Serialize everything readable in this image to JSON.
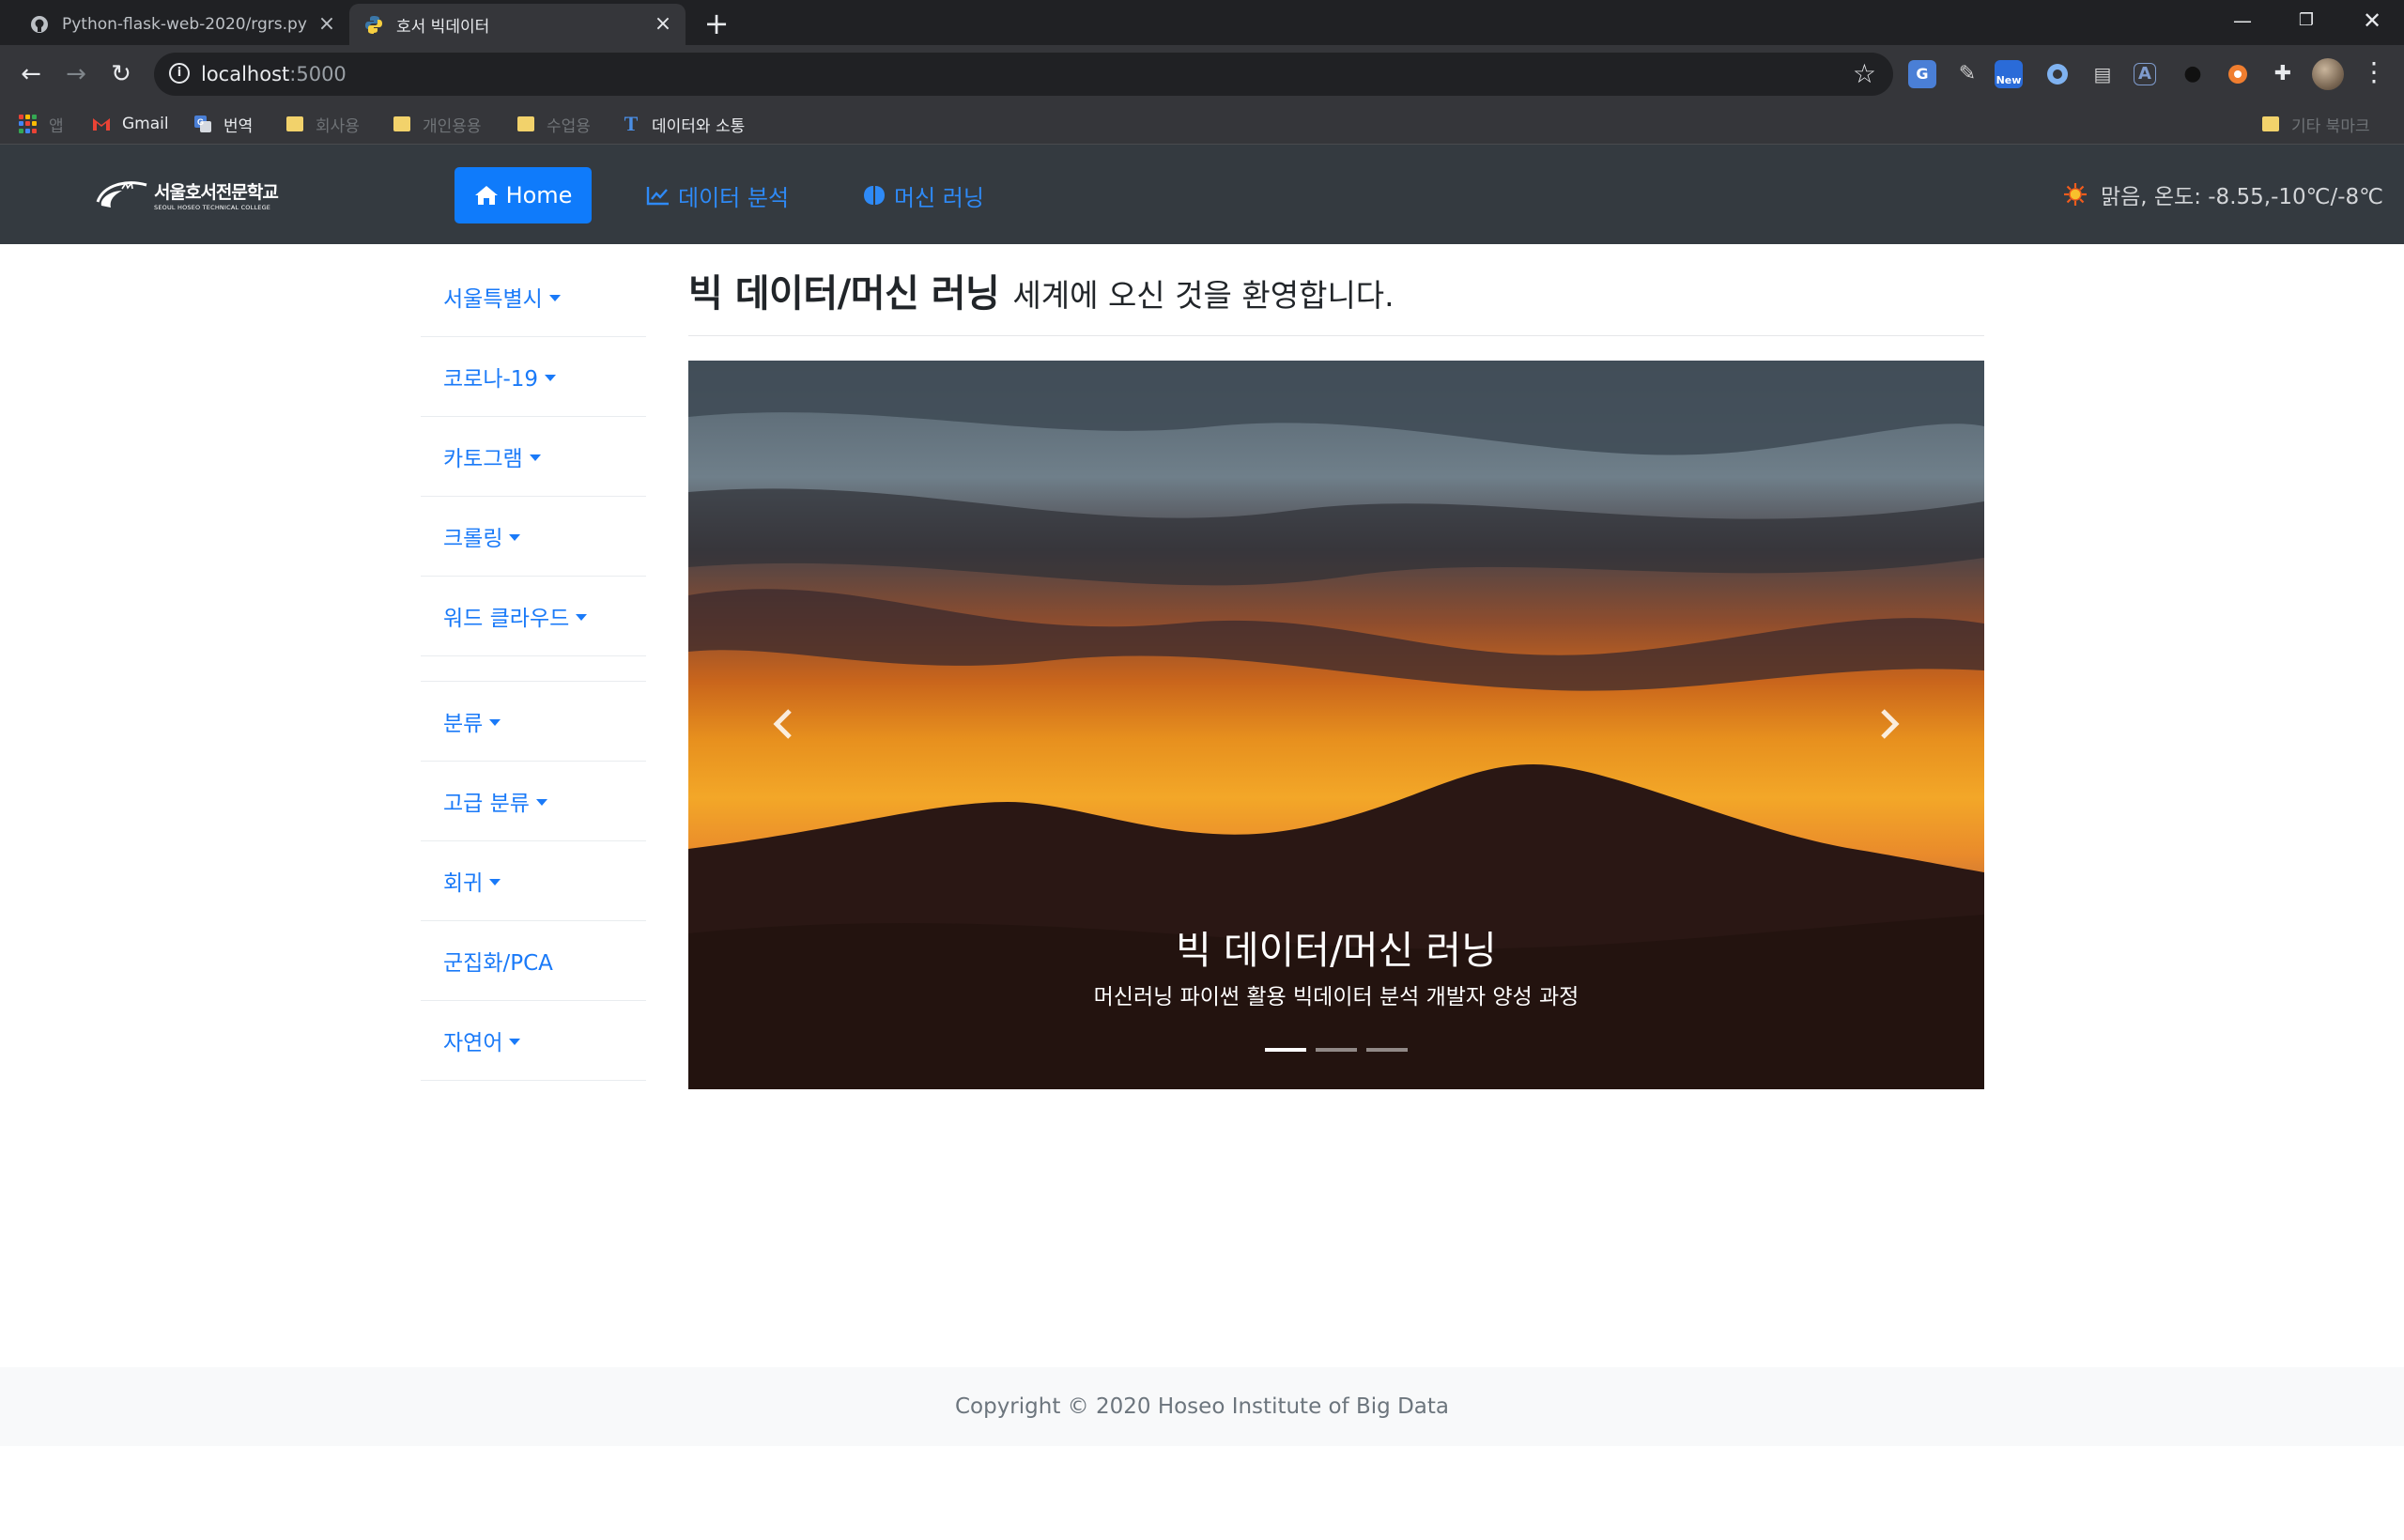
{
  "browser": {
    "tabs": [
      {
        "title": "Python-flask-web-2020/rgrs.py",
        "icon": "github-icon",
        "active": false
      },
      {
        "title": "호서 빅데이터",
        "icon": "python-icon",
        "active": true
      }
    ],
    "url_host": "localhost",
    "url_port": ":5000",
    "bookmarks": [
      {
        "label": "앱",
        "icon": "apps-grid-icon",
        "dim": true
      },
      {
        "label": "Gmail",
        "icon": "gmail-icon",
        "dim": false
      },
      {
        "label": "번역",
        "icon": "translate-icon",
        "dim": false
      },
      {
        "label": "회사용",
        "icon": "folder-icon",
        "dim": true
      },
      {
        "label": "개인용용",
        "icon": "folder-icon",
        "dim": true
      },
      {
        "label": "수업용",
        "icon": "folder-icon",
        "dim": true
      },
      {
        "label": "데이터와 소통",
        "icon": "t-logo-icon",
        "dim": false
      }
    ],
    "other_bookmarks": "기타 북마크",
    "new_badge": "New"
  },
  "site": {
    "logo_text": "서울호서전문학교",
    "logo_subtext": "SEOUL HOSEO TECHNICAL COLLEGE",
    "nav": {
      "home": "Home",
      "data_analysis": "데이터 분석",
      "machine_learning": "머신 러닝"
    },
    "weather": "맑음, 온도: -8.55,-10℃/-8℃",
    "accent_color": "#0f7bfb"
  },
  "sidebar": {
    "items": [
      {
        "label": "서울특별시",
        "dropdown": true
      },
      {
        "label": "코로나-19",
        "dropdown": true
      },
      {
        "label": "카토그램",
        "dropdown": true
      },
      {
        "label": "크롤링",
        "dropdown": true
      },
      {
        "label": "워드 클라우드",
        "dropdown": true
      },
      {
        "label": "분류",
        "dropdown": true
      },
      {
        "label": "고급 분류",
        "dropdown": true
      },
      {
        "label": "회귀",
        "dropdown": true
      },
      {
        "label": "군집화/PCA",
        "dropdown": false
      },
      {
        "label": "자연어",
        "dropdown": true
      }
    ]
  },
  "main": {
    "heading_bold": "빅 데이터/머신 러닝",
    "heading_rest": "세계에 오신 것을 환영합니다.",
    "carousel": {
      "caption_title": "빅 데이터/머신 러닝",
      "caption_sub": "머신러닝 파이썬 활용 빅데이터 분석 개발자 양성 과정",
      "slide_count": 3,
      "active_slide": 1
    }
  },
  "footer": {
    "text": "Copyright © 2020 Hoseo Institute of Big Data"
  }
}
